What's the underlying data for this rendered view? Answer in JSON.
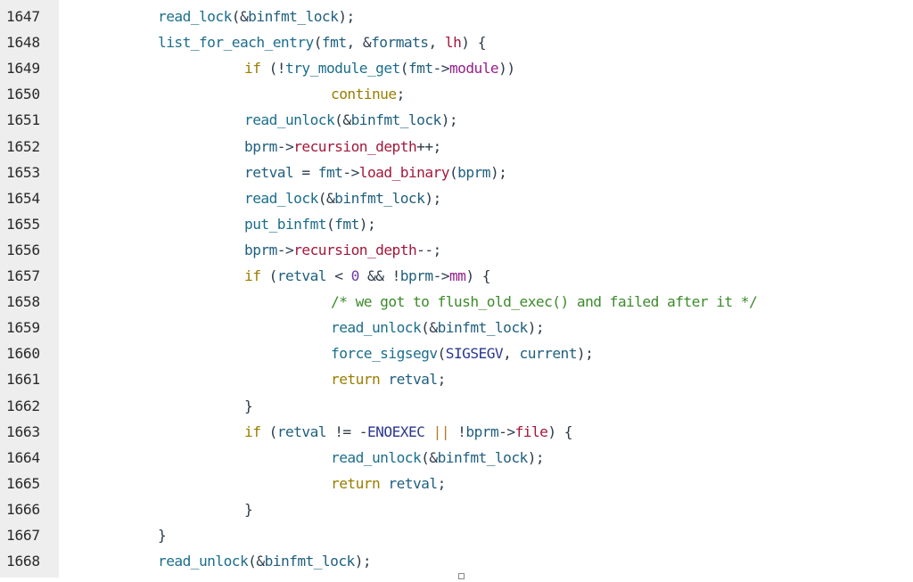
{
  "code_view": {
    "lines": [
      {
        "number": "1647",
        "indent": 0,
        "tokens": [
          {
            "t": "read_lock",
            "k": "fn"
          },
          {
            "t": "(&",
            "k": "pn"
          },
          {
            "t": "binfmt_lock",
            "k": "id"
          },
          {
            "t": ");",
            "k": "pn"
          }
        ]
      },
      {
        "number": "1648",
        "indent": 0,
        "tokens": [
          {
            "t": "list_for_each_entry",
            "k": "fn"
          },
          {
            "t": "(",
            "k": "pn"
          },
          {
            "t": "fmt",
            "k": "id"
          },
          {
            "t": ", &",
            "k": "pn"
          },
          {
            "t": "formats",
            "k": "id"
          },
          {
            "t": ", ",
            "k": "pn"
          },
          {
            "t": "lh",
            "k": "mem"
          },
          {
            "t": ") {",
            "k": "pn"
          }
        ]
      },
      {
        "number": "1649",
        "indent": 1,
        "tokens": [
          {
            "t": "if",
            "k": "kw"
          },
          {
            "t": " (!",
            "k": "pn"
          },
          {
            "t": "try_module_get",
            "k": "fn"
          },
          {
            "t": "(",
            "k": "pn"
          },
          {
            "t": "fmt",
            "k": "id"
          },
          {
            "t": "->",
            "k": "op"
          },
          {
            "t": "module",
            "k": "mag"
          },
          {
            "t": "))",
            "k": "pn"
          }
        ]
      },
      {
        "number": "1650",
        "indent": 2,
        "tokens": [
          {
            "t": "continue",
            "k": "kw"
          },
          {
            "t": ";",
            "k": "pn"
          }
        ]
      },
      {
        "number": "1651",
        "indent": 1,
        "tokens": [
          {
            "t": "read_unlock",
            "k": "fn"
          },
          {
            "t": "(&",
            "k": "pn"
          },
          {
            "t": "binfmt_lock",
            "k": "id"
          },
          {
            "t": ");",
            "k": "pn"
          }
        ]
      },
      {
        "number": "1652",
        "indent": 1,
        "tokens": [
          {
            "t": "bprm",
            "k": "id"
          },
          {
            "t": "->",
            "k": "op"
          },
          {
            "t": "recursion_depth",
            "k": "mem"
          },
          {
            "t": "++;",
            "k": "pn"
          }
        ]
      },
      {
        "number": "1653",
        "indent": 1,
        "tokens": [
          {
            "t": "retval",
            "k": "id"
          },
          {
            "t": " = ",
            "k": "pn"
          },
          {
            "t": "fmt",
            "k": "id"
          },
          {
            "t": "->",
            "k": "op"
          },
          {
            "t": "load_binary",
            "k": "mem"
          },
          {
            "t": "(",
            "k": "pn"
          },
          {
            "t": "bprm",
            "k": "id"
          },
          {
            "t": ");",
            "k": "pn"
          }
        ]
      },
      {
        "number": "1654",
        "indent": 1,
        "tokens": [
          {
            "t": "read_lock",
            "k": "fn"
          },
          {
            "t": "(&",
            "k": "pn"
          },
          {
            "t": "binfmt_lock",
            "k": "id"
          },
          {
            "t": ");",
            "k": "pn"
          }
        ]
      },
      {
        "number": "1655",
        "indent": 1,
        "tokens": [
          {
            "t": "put_binfmt",
            "k": "fn"
          },
          {
            "t": "(",
            "k": "pn"
          },
          {
            "t": "fmt",
            "k": "id"
          },
          {
            "t": ");",
            "k": "pn"
          }
        ]
      },
      {
        "number": "1656",
        "indent": 1,
        "tokens": [
          {
            "t": "bprm",
            "k": "id"
          },
          {
            "t": "->",
            "k": "op"
          },
          {
            "t": "recursion_depth",
            "k": "mem"
          },
          {
            "t": "--;",
            "k": "pn"
          }
        ]
      },
      {
        "number": "1657",
        "indent": 1,
        "tokens": [
          {
            "t": "if",
            "k": "kw"
          },
          {
            "t": " (",
            "k": "pn"
          },
          {
            "t": "retval",
            "k": "id"
          },
          {
            "t": " < ",
            "k": "pn"
          },
          {
            "t": "0",
            "k": "num"
          },
          {
            "t": " && !",
            "k": "pn"
          },
          {
            "t": "bprm",
            "k": "id"
          },
          {
            "t": "->",
            "k": "op"
          },
          {
            "t": "mm",
            "k": "mag"
          },
          {
            "t": ") {",
            "k": "pn"
          }
        ]
      },
      {
        "number": "1658",
        "indent": 2,
        "tokens": [
          {
            "t": "/* we got to flush_old_exec() and failed after it */",
            "k": "cm"
          }
        ]
      },
      {
        "number": "1659",
        "indent": 2,
        "tokens": [
          {
            "t": "read_unlock",
            "k": "fn"
          },
          {
            "t": "(&",
            "k": "pn"
          },
          {
            "t": "binfmt_lock",
            "k": "id"
          },
          {
            "t": ");",
            "k": "pn"
          }
        ]
      },
      {
        "number": "1660",
        "indent": 2,
        "tokens": [
          {
            "t": "force_sigsegv",
            "k": "fn"
          },
          {
            "t": "(",
            "k": "pn"
          },
          {
            "t": "SIGSEGV",
            "k": "const"
          },
          {
            "t": ", ",
            "k": "pn"
          },
          {
            "t": "current",
            "k": "id"
          },
          {
            "t": ");",
            "k": "pn"
          }
        ]
      },
      {
        "number": "1661",
        "indent": 2,
        "tokens": [
          {
            "t": "return",
            "k": "kw"
          },
          {
            "t": " ",
            "k": "pn"
          },
          {
            "t": "retval",
            "k": "id"
          },
          {
            "t": ";",
            "k": "pn"
          }
        ]
      },
      {
        "number": "1662",
        "indent": 1,
        "tokens": [
          {
            "t": "}",
            "k": "pn"
          }
        ]
      },
      {
        "number": "1663",
        "indent": 1,
        "tokens": [
          {
            "t": "if",
            "k": "kw"
          },
          {
            "t": " (",
            "k": "pn"
          },
          {
            "t": "retval",
            "k": "id"
          },
          {
            "t": " != -",
            "k": "pn"
          },
          {
            "t": "ENOEXEC",
            "k": "const"
          },
          {
            "t": " ",
            "k": "pn"
          },
          {
            "t": "||",
            "k": "or"
          },
          {
            "t": " !",
            "k": "pn"
          },
          {
            "t": "bprm",
            "k": "id"
          },
          {
            "t": "->",
            "k": "op"
          },
          {
            "t": "file",
            "k": "mem"
          },
          {
            "t": ") {",
            "k": "pn"
          }
        ]
      },
      {
        "number": "1664",
        "indent": 2,
        "tokens": [
          {
            "t": "read_unlock",
            "k": "fn"
          },
          {
            "t": "(&",
            "k": "pn"
          },
          {
            "t": "binfmt_lock",
            "k": "id"
          },
          {
            "t": ");",
            "k": "pn"
          }
        ]
      },
      {
        "number": "1665",
        "indent": 2,
        "tokens": [
          {
            "t": "return",
            "k": "kw"
          },
          {
            "t": " ",
            "k": "pn"
          },
          {
            "t": "retval",
            "k": "id"
          },
          {
            "t": ";",
            "k": "pn"
          }
        ]
      },
      {
        "number": "1666",
        "indent": 1,
        "tokens": [
          {
            "t": "}",
            "k": "pn"
          }
        ]
      },
      {
        "number": "1667",
        "indent": 0,
        "tokens": [
          {
            "t": "}",
            "k": "pn"
          }
        ]
      },
      {
        "number": "1668",
        "indent": 0,
        "tokens": [
          {
            "t": "read_unlock",
            "k": "fn"
          },
          {
            "t": "(&",
            "k": "pn"
          },
          {
            "t": "binfmt_lock",
            "k": "id"
          },
          {
            "t": ");",
            "k": "pn"
          }
        ]
      }
    ]
  },
  "colors": {
    "gutter_bg": "#eeeeee",
    "keyword": "#9a7d00",
    "function": "#1b6e8c",
    "member": "#a3183a",
    "comment": "#3c8a2a",
    "constant": "#2b378e",
    "number": "#6c3aa8"
  }
}
